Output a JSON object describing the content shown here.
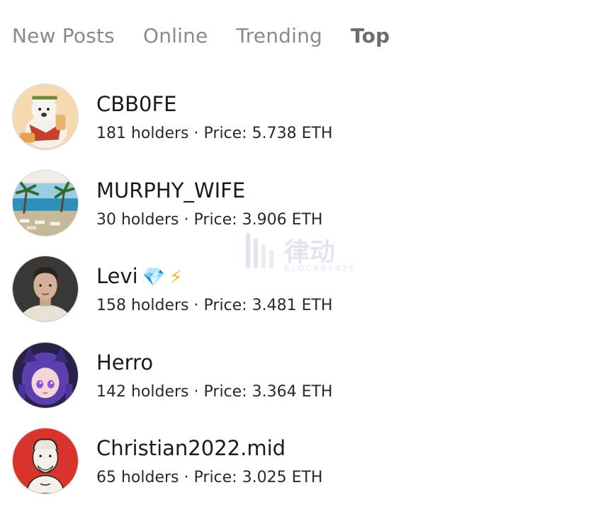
{
  "tabs": [
    {
      "label": "New Posts",
      "active": false
    },
    {
      "label": "Online",
      "active": false
    },
    {
      "label": "Trending",
      "active": false
    },
    {
      "label": "Top",
      "active": true
    }
  ],
  "users": [
    {
      "name": "CBB0FE",
      "holders": "181 holders",
      "separator": "·",
      "price": "Price: 5.738 ETH",
      "avatar": "polar-bear-avatar"
    },
    {
      "name": "MURPHY_WIFE",
      "holders": "30 holders",
      "separator": "·",
      "price": "Price: 3.906 ETH",
      "avatar": "beach-resort-avatar"
    },
    {
      "name": "Levi",
      "emoji": [
        "💎",
        "⚡"
      ],
      "holders": "158 holders",
      "separator": "·",
      "price": "Price: 3.481 ETH",
      "avatar": "man-portrait-avatar"
    },
    {
      "name": "Herro",
      "holders": "142 holders",
      "separator": "·",
      "price": "Price: 3.364 ETH",
      "avatar": "anime-girl-avatar"
    },
    {
      "name": "Christian2022.mid",
      "holders": "65 holders",
      "separator": "·",
      "price": "Price: 3.025 ETH",
      "avatar": "sketch-man-avatar"
    }
  ],
  "watermark": {
    "text": "律动",
    "sub": "BLOCKBEATS"
  },
  "colors": {
    "tab_inactive": "#8a8a8a",
    "tab_active": "#6d6d6d",
    "text": "#1b1b1b"
  }
}
